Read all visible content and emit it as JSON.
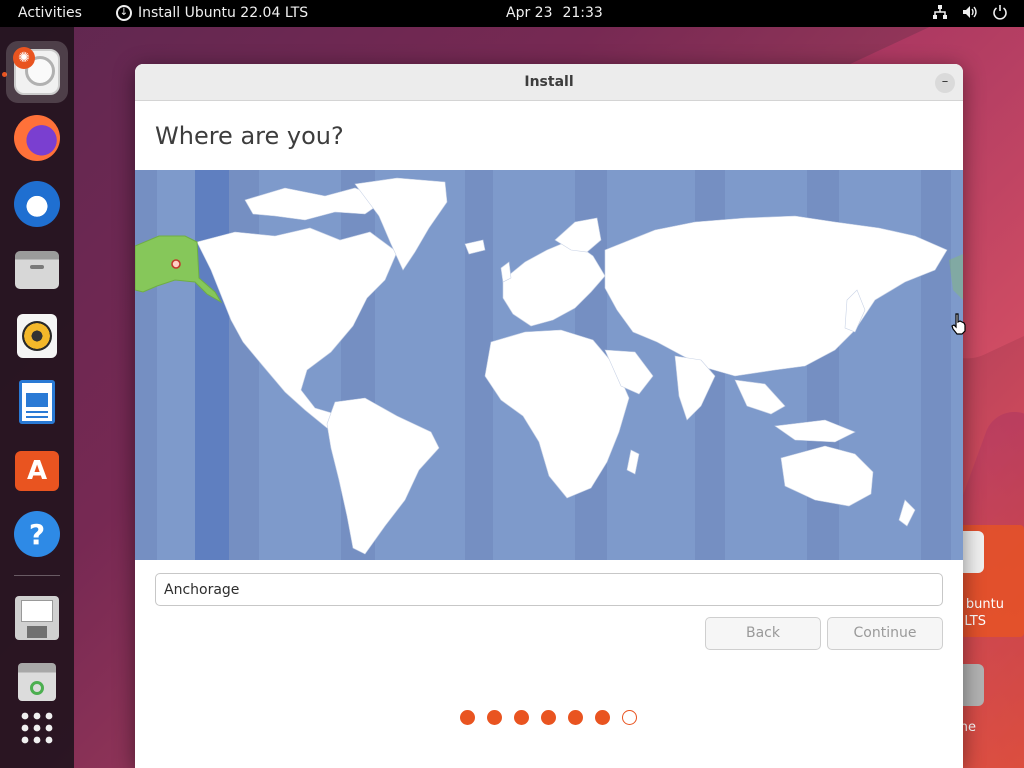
{
  "topbar": {
    "activities": "Activities",
    "app_title": "Install Ubuntu 22.04 LTS",
    "date": "Apr 23",
    "time": "21:33",
    "tray_icons": [
      "network-icon",
      "volume-icon",
      "power-icon"
    ]
  },
  "dock": {
    "items": [
      {
        "name": "ubuntu-installer",
        "icon": "installer-icon",
        "active": true
      },
      {
        "name": "firefox",
        "icon": "firefox-icon"
      },
      {
        "name": "thunderbird",
        "icon": "thunderbird-icon"
      },
      {
        "name": "files",
        "icon": "files-icon"
      },
      {
        "name": "rhythmbox",
        "icon": "rhythmbox-icon"
      },
      {
        "name": "libreoffice-writer",
        "icon": "writer-icon"
      },
      {
        "name": "app-center",
        "icon": "app-center-icon"
      },
      {
        "name": "help",
        "icon": "help-icon"
      },
      {
        "name": "disk-image",
        "icon": "disk-image-icon"
      },
      {
        "name": "trash",
        "icon": "trash-icon"
      },
      {
        "name": "show-apps",
        "icon": "app-grid-icon"
      }
    ]
  },
  "desktop": {
    "icon1_label_line1": "buntu",
    "icon1_label_line2": "LTS",
    "icon2_label": "ne"
  },
  "window": {
    "title": "Install",
    "minimize_label": "–",
    "heading": "Where are you?",
    "city_value": "Anchorage",
    "back_label": "Back",
    "continue_label": "Continue",
    "steps_total": 7,
    "steps_done": 6
  },
  "colors": {
    "accent": "#e95420",
    "map_ocean": "#7e9acb",
    "selected_zone": "#86c75a"
  }
}
